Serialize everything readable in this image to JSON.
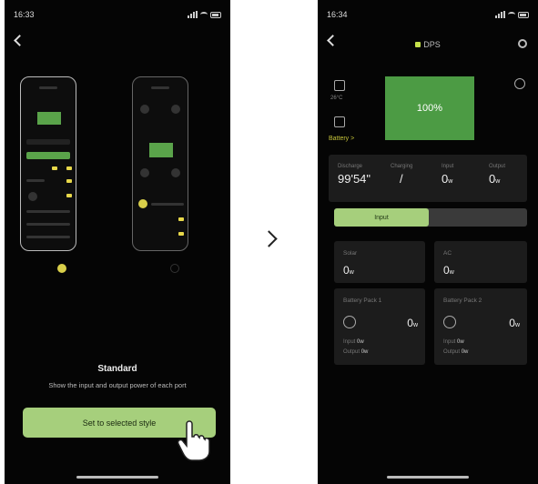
{
  "screen1": {
    "status_time": "16:33",
    "style_title": "Standard",
    "style_description": "Show the input and output power of each port",
    "set_button_label": "Set to selected style"
  },
  "screen2": {
    "status_time": "16:34",
    "device_name": "DPS",
    "battery_percent": "100%",
    "battery_link": "Battery >",
    "stats": [
      {
        "label": "Discharge",
        "value": "99'54\"",
        "unit": ""
      },
      {
        "label": "Charging",
        "value": "/",
        "unit": ""
      },
      {
        "label": "Input",
        "value": "0",
        "unit": "w"
      },
      {
        "label": "Output",
        "value": "0",
        "unit": "w"
      }
    ],
    "tabs": {
      "input": "Input",
      "output": ""
    },
    "solar": {
      "label": "Solar",
      "value": "0",
      "unit": "w"
    },
    "ac": {
      "label": "AC",
      "value": "0",
      "unit": "w"
    },
    "pack1": {
      "label": "Battery Pack 1",
      "value": "0",
      "unit": "w",
      "input_label": "Input",
      "input_value": "0w",
      "output_label": "Output",
      "output_value": "0w"
    },
    "pack2": {
      "label": "Battery Pack 2",
      "value": "0",
      "unit": "w",
      "input_label": "Input",
      "input_value": "0w",
      "output_label": "Output",
      "output_value": "0w"
    }
  },
  "colors": {
    "accent_green": "#a6cf7c",
    "panel_green": "#4c9b44",
    "highlight_yellow": "#d9cf4a"
  }
}
